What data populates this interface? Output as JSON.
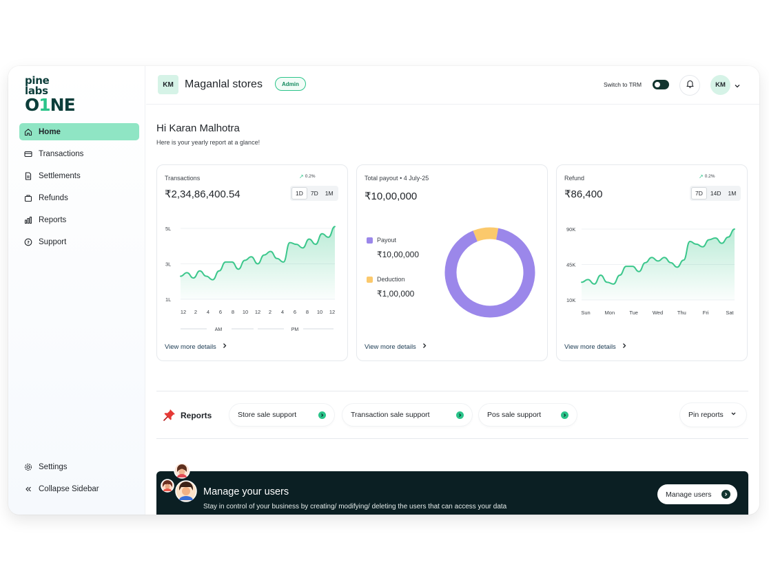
{
  "brand": {
    "logo_top": "pine labs",
    "logo_bottom_a": "O",
    "logo_bottom_1": "1",
    "logo_bottom_b": "NE"
  },
  "sidebar": {
    "items": [
      {
        "label": "Home",
        "icon": "home-icon",
        "active": true
      },
      {
        "label": "Transactions",
        "icon": "card-icon"
      },
      {
        "label": "Settlements",
        "icon": "document-icon"
      },
      {
        "label": "Refunds",
        "icon": "bag-icon"
      },
      {
        "label": "Reports",
        "icon": "bar-chart-icon"
      },
      {
        "label": "Support",
        "icon": "help-circle-icon"
      }
    ],
    "bottom": [
      {
        "label": "Settings",
        "icon": "gear-icon"
      },
      {
        "label": "Collapse Sidebar",
        "icon": "double-chevron-left-icon"
      }
    ]
  },
  "topbar": {
    "store_initials": "KM",
    "store_name": "Maganlal stores",
    "role_badge": "Admin",
    "switch_label": "Switch to TRM",
    "user_initials": "KM"
  },
  "greeting": {
    "title": "Hi Karan Malhotra",
    "subtitle": "Here is your yearly report at a glance!"
  },
  "cards": {
    "transactions": {
      "title": "Transactions",
      "value": "₹2,34,86,400.54",
      "trend": "0.2%",
      "ranges": [
        "1D",
        "7D",
        "1M"
      ],
      "active_range": "1D",
      "link": "View more details"
    },
    "payout": {
      "title": "Total payout",
      "date": "• 4 July-25",
      "value": "₹10,00,000",
      "legend": [
        {
          "label": "Payout",
          "value": "₹10,00,000",
          "color": "#9b87ea"
        },
        {
          "label": "Deduction",
          "value": "₹1,00,000",
          "color": "#fbc96c"
        }
      ],
      "link": "View more details"
    },
    "refund": {
      "title": "Refund",
      "value": "₹86,400",
      "trend": "0.2%",
      "ranges": [
        "7D",
        "14D",
        "1M"
      ],
      "active_range": "7D",
      "link": "View more details"
    }
  },
  "chart_data": [
    {
      "type": "area",
      "title": "Transactions",
      "yticks": [
        "5L",
        "3L",
        "1L"
      ],
      "ylim": [
        1,
        5
      ],
      "categories": [
        "12",
        "2",
        "4",
        "6",
        "8",
        "10",
        "12",
        "2",
        "4",
        "6",
        "8",
        "10",
        "12"
      ],
      "period_labels": [
        "AM",
        "PM"
      ],
      "x": [
        0,
        0.5,
        1,
        1.5,
        2,
        2.5,
        3,
        3.5,
        4,
        4.5,
        5,
        5.5,
        6,
        6.5,
        7,
        7.5,
        8,
        8.5,
        9,
        9.5,
        10,
        10.5,
        11,
        11.5,
        12
      ],
      "values": [
        2.3,
        2.5,
        2.2,
        2.6,
        2.3,
        2.1,
        2.6,
        3.1,
        3.1,
        2.7,
        3.2,
        3.4,
        3.0,
        3.5,
        3.7,
        3.3,
        3.1,
        4.2,
        4.1,
        3.9,
        4.4,
        4.1,
        4.7,
        4.5,
        5.1
      ],
      "color": "#3cc78c",
      "grid": true
    },
    {
      "type": "pie",
      "title": "Total payout",
      "categories": [
        "Payout",
        "Deduction"
      ],
      "values": [
        10,
        1
      ],
      "colors": [
        "#9b87ea",
        "#fbc96c"
      ],
      "donut": true
    },
    {
      "type": "area",
      "title": "Refund",
      "yticks": [
        "90K",
        "45K",
        "10K"
      ],
      "ylim": [
        10,
        90
      ],
      "categories": [
        "Sun",
        "Mon",
        "Tue",
        "Wed",
        "Thu",
        "Fri",
        "Sat"
      ],
      "x": [
        0,
        0.25,
        0.5,
        0.75,
        1,
        1.25,
        1.5,
        1.75,
        2,
        2.25,
        2.5,
        2.75,
        3,
        3.25,
        3.5,
        3.75,
        4,
        4.25,
        4.5,
        4.75,
        5,
        5.25,
        5.5,
        5.75,
        6
      ],
      "values": [
        30,
        33,
        28,
        38,
        30,
        28,
        38,
        48,
        48,
        42,
        52,
        58,
        54,
        58,
        52,
        47,
        55,
        76,
        73,
        70,
        78,
        80,
        74,
        81,
        90
      ],
      "color": "#3cc78c",
      "grid": true
    }
  ],
  "reports": {
    "title": "Reports",
    "chips": [
      "Store sale support",
      "Transaction sale support",
      "Pos sale support"
    ],
    "pin_label": "Pin reports"
  },
  "banner": {
    "title": "Manage your users",
    "subtitle": "Stay in control of your business by creating/ modifying/ deleting the users that can access your data",
    "button": "Manage users"
  }
}
